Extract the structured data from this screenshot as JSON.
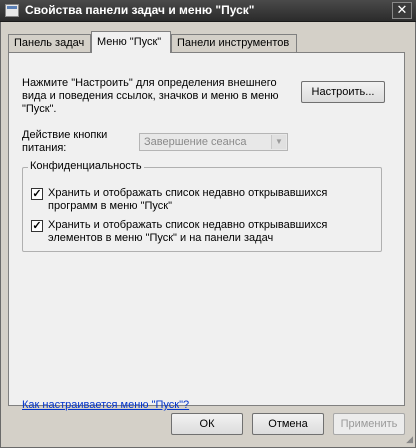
{
  "window": {
    "title": "Свойства панели задач и меню \"Пуск\"",
    "close_symbol": "✕",
    "icon": "taskbar-properties-icon"
  },
  "tabs": [
    {
      "label": "Панель задач",
      "active": false
    },
    {
      "label": "Меню \"Пуск\"",
      "active": true
    },
    {
      "label": "Панели инструментов",
      "active": false
    }
  ],
  "start_menu": {
    "description": "Нажмите \"Настроить\" для определения внешнего вида и поведения ссылок, значков и меню в меню \"Пуск\".",
    "customize_button": "Настроить...",
    "power_label": "Действие кнопки питания:",
    "power_value": "Завершение сеанса",
    "power_enabled": false,
    "privacy_group": "Конфиденциальность",
    "privacy_options": [
      {
        "label": "Хранить и отображать список недавно открывавшихся программ в меню \"Пуск\"",
        "checked": true
      },
      {
        "label": "Хранить и отображать список недавно открывавшихся элементов в меню \"Пуск\" и на панели задач",
        "checked": true
      }
    ],
    "help_link": "Как настраивается меню \"Пуск\"?"
  },
  "footer": {
    "ok": "ОК",
    "cancel": "Отмена",
    "apply": "Применить",
    "apply_enabled": false
  },
  "colors": {
    "titlebar": "#2b2b2b",
    "link": "#0033cc",
    "panel_bg": "#f0f0f0"
  }
}
